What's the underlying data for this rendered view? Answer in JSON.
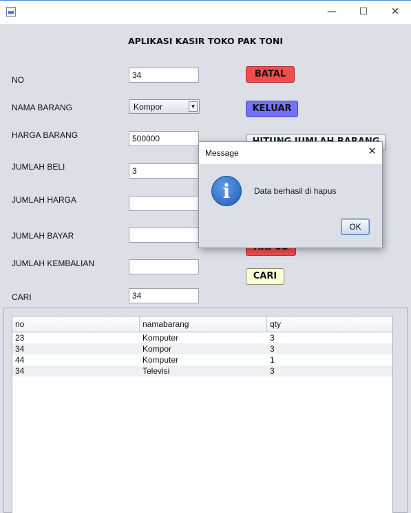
{
  "window": {
    "minimize_glyph": "—",
    "maximize_glyph": "☐",
    "close_glyph": "✕"
  },
  "app_title": "APLIKASI KASIR TOKO PAK TONI",
  "form": {
    "no_label": "NO",
    "no_value": "34",
    "nama_barang_label": "NAMA BARANG",
    "nama_barang_selected": "Kompor",
    "harga_barang_label": "HARGA BARANG",
    "harga_barang_value": "500000",
    "jumlah_beli_label": "JUMLAH BELI",
    "jumlah_beli_value": "3",
    "jumlah_harga_label": "JUMLAH HARGA",
    "jumlah_harga_value": "",
    "jumlah_bayar_label": "JUMLAH BAYAR",
    "jumlah_bayar_value": "",
    "jumlah_kembalian_label": "JUMLAH KEMBALIAN",
    "jumlah_kembalian_value": "",
    "cari_label": "CARI",
    "cari_value": "34"
  },
  "buttons": {
    "batal": "BATAL",
    "keluar": "KELUAR",
    "hitung": "HITUNG JUMLAH BARANG",
    "hapus": "HAPUS",
    "cari": "CARI"
  },
  "table": {
    "columns": [
      "no",
      "namabarang",
      "qty"
    ],
    "rows": [
      [
        "23",
        "Komputer",
        "3"
      ],
      [
        "34",
        "Kompor",
        "3"
      ],
      [
        "44",
        "Komputer",
        "1"
      ],
      [
        "34",
        "Televisi",
        "3"
      ]
    ]
  },
  "dialog": {
    "title": "Message",
    "close_glyph": "✕",
    "icon": "info-icon",
    "icon_glyph": "i",
    "message": "Data berhasil di hapus",
    "ok_label": "OK"
  },
  "colors": {
    "batal": "#f34c4c",
    "keluar": "#7472ff",
    "hapus": "#f34c4c",
    "cari": "#ffffd6",
    "window_bg": "#dcdfe5"
  }
}
